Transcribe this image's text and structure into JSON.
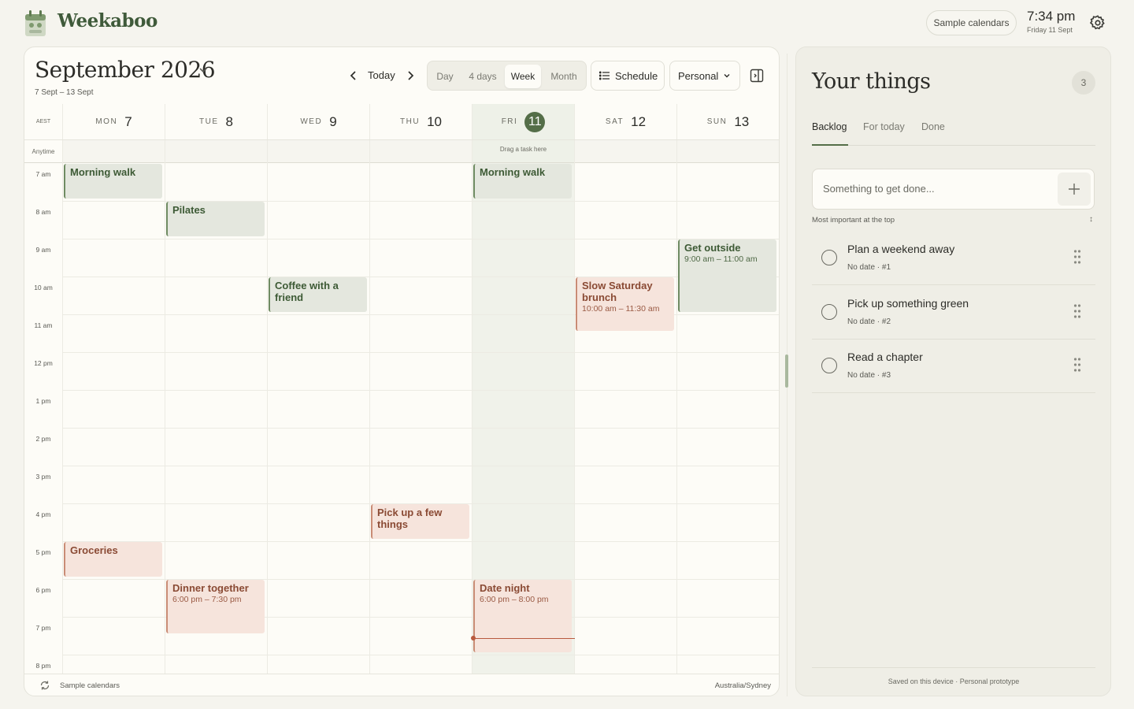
{
  "app": {
    "name": "Weekaboo"
  },
  "header": {
    "sample_calendars": "Sample calendars",
    "time": "7:34 pm",
    "date": "Friday 11 Sept"
  },
  "calendar": {
    "title": "September 2026",
    "range": "7 Sept – 13 Sept",
    "today_label": "Today",
    "views": [
      "Day",
      "4 days",
      "Week",
      "Month"
    ],
    "active_view": "Week",
    "schedule_label": "Schedule",
    "calendar_select": "Personal",
    "timezone_abbr": "AEST",
    "anytime_label": "Anytime",
    "drag_hint": "Drag a task here",
    "days": [
      {
        "dow": "MON",
        "num": "7"
      },
      {
        "dow": "TUE",
        "num": "8"
      },
      {
        "dow": "WED",
        "num": "9"
      },
      {
        "dow": "THU",
        "num": "10"
      },
      {
        "dow": "FRI",
        "num": "11"
      },
      {
        "dow": "SAT",
        "num": "12"
      },
      {
        "dow": "SUN",
        "num": "13"
      }
    ],
    "today_index": 4,
    "hours": [
      "7 am",
      "8 am",
      "9 am",
      "10 am",
      "11 am",
      "12 pm",
      "1 pm",
      "2 pm",
      "3 pm",
      "4 pm",
      "5 pm",
      "6 pm",
      "7 pm",
      "8 pm"
    ],
    "events": [
      {
        "day": 0,
        "start": 7,
        "end": 8,
        "title": "Morning walk",
        "time": "",
        "color": "green"
      },
      {
        "day": 4,
        "start": 7,
        "end": 8,
        "title": "Morning walk",
        "time": "",
        "color": "green"
      },
      {
        "day": 1,
        "start": 8,
        "end": 9,
        "title": "Pilates",
        "time": "",
        "color": "green"
      },
      {
        "day": 6,
        "start": 9,
        "end": 11,
        "title": "Get outside",
        "time": "9:00 am – 11:00 am",
        "color": "green"
      },
      {
        "day": 2,
        "start": 10,
        "end": 11,
        "title": "Coffee with a friend",
        "time": "",
        "color": "green"
      },
      {
        "day": 5,
        "start": 10,
        "end": 11.5,
        "title": "Slow Saturday brunch",
        "time": "10:00 am – 11:30 am",
        "color": "pink"
      },
      {
        "day": 3,
        "start": 16,
        "end": 17,
        "title": "Pick up a few things",
        "time": "",
        "color": "pink"
      },
      {
        "day": 0,
        "start": 17,
        "end": 18,
        "title": "Groceries",
        "time": "",
        "color": "pink"
      },
      {
        "day": 1,
        "start": 18,
        "end": 19.5,
        "title": "Dinner together",
        "time": "6:00 pm – 7:30 pm",
        "color": "pink"
      },
      {
        "day": 4,
        "start": 18,
        "end": 20,
        "title": "Date night",
        "time": "6:00 pm – 8:00 pm",
        "color": "pink"
      }
    ],
    "now_hour": 19.5667,
    "footer_left": "Sample calendars",
    "footer_right": "Australia/Sydney"
  },
  "side": {
    "title": "Your things",
    "count": "3",
    "tabs": [
      "Backlog",
      "For today",
      "Done"
    ],
    "active_tab": "Backlog",
    "add_placeholder": "Something to get done...",
    "sort_hint": "Most important at the top",
    "tasks": [
      {
        "title": "Plan a weekend away",
        "meta": "No date · #1"
      },
      {
        "title": "Pick up something green",
        "meta": "No date · #2"
      },
      {
        "title": "Read a chapter",
        "meta": "No date · #3"
      }
    ],
    "footer": "Saved on this device · Personal prototype"
  },
  "colors": {
    "accent": "#546e48",
    "now_line": "#b85a3e"
  }
}
